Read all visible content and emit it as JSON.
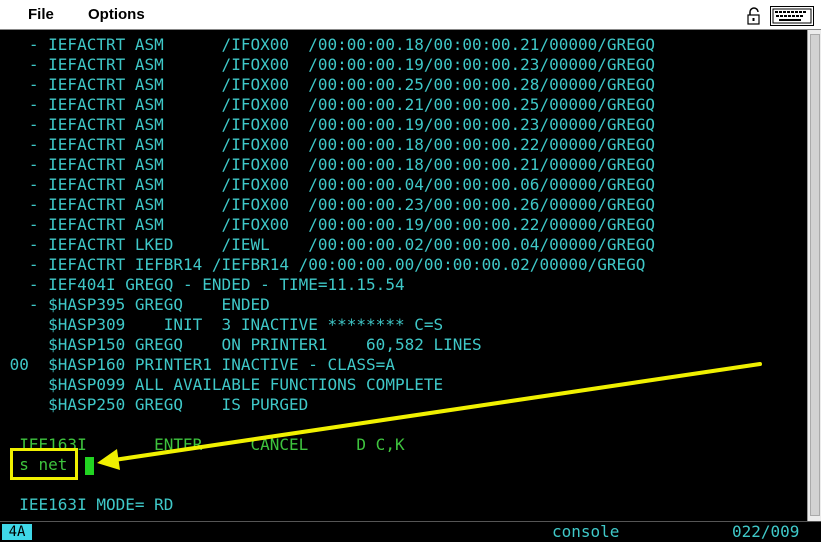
{
  "menu": {
    "file": "File",
    "options": "Options"
  },
  "icons": {
    "lock": "lock-icon",
    "keyboard": "keyboard-icon"
  },
  "colors": {
    "terminal_text": "#3fc8c8",
    "input_text": "#3ec43e",
    "cursor": "#22d422",
    "annotation": "#f0f000"
  },
  "screen": {
    "lines": [
      "   - IEFACTRT ASM      /IFOX00  /00:00:00.18/00:00:00.21/00000/GREGQ",
      "   - IEFACTRT ASM      /IFOX00  /00:00:00.19/00:00:00.23/00000/GREGQ",
      "   - IEFACTRT ASM      /IFOX00  /00:00:00.25/00:00:00.28/00000/GREGQ",
      "   - IEFACTRT ASM      /IFOX00  /00:00:00.21/00:00:00.25/00000/GREGQ",
      "   - IEFACTRT ASM      /IFOX00  /00:00:00.19/00:00:00.23/00000/GREGQ",
      "   - IEFACTRT ASM      /IFOX00  /00:00:00.18/00:00:00.22/00000/GREGQ",
      "   - IEFACTRT ASM      /IFOX00  /00:00:00.18/00:00:00.21/00000/GREGQ",
      "   - IEFACTRT ASM      /IFOX00  /00:00:00.04/00:00:00.06/00000/GREGQ",
      "   - IEFACTRT ASM      /IFOX00  /00:00:00.23/00:00:00.26/00000/GREGQ",
      "   - IEFACTRT ASM      /IFOX00  /00:00:00.19/00:00:00.22/00000/GREGQ",
      "   - IEFACTRT LKED     /IEWL    /00:00:00.02/00:00:00.04/00000/GREGQ",
      "   - IEFACTRT IEFBR14 /IEFBR14 /00:00:00.00/00:00:00.02/00000/GREGQ",
      "   - IEF404I GREGQ - ENDED - TIME=11.15.54",
      "   - $HASP395 GREGQ    ENDED",
      "     $HASP309    INIT  3 INACTIVE ******** C=S",
      "     $HASP150 GREGQ    ON PRINTER1    60,582 LINES",
      " 00  $HASP160 PRINTER1 INACTIVE - CLASS=A",
      "     $HASP099 ALL AVAILABLE FUNCTIONS COMPLETE",
      "     $HASP250 GREGQ    IS PURGED",
      "",
      "  IEE163I       ENTER     CANCEL     D C,K"
    ],
    "input": "  s net",
    "mode_line": "  IEE163I MODE= RD"
  },
  "status": {
    "indicator": "4A",
    "mode": "console",
    "position": "022/009"
  }
}
